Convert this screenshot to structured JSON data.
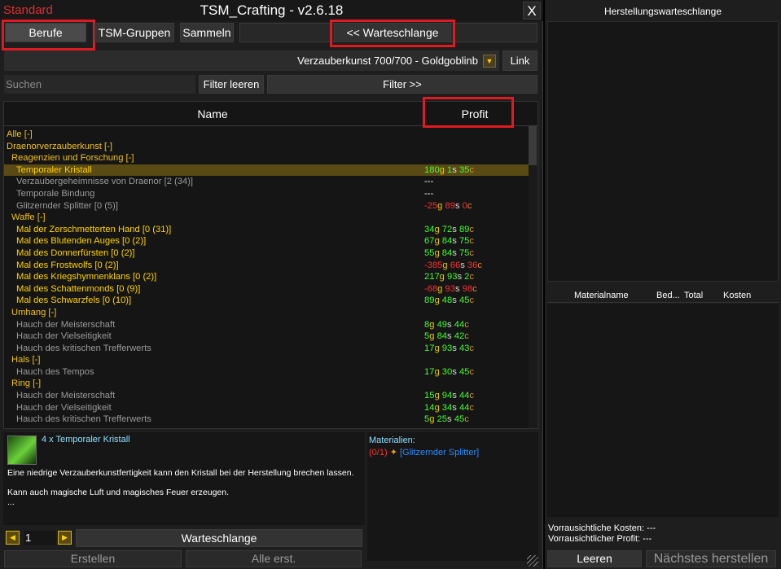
{
  "window": {
    "profile": "Standard",
    "title": "TSM_Crafting - v2.6.18",
    "close": "X"
  },
  "tabs": {
    "berufe": "Berufe",
    "gruppen": "TSM-Gruppen",
    "sammeln": "Sammeln",
    "queue_toggle": "<< Warteschlange"
  },
  "profession": {
    "name": "Verzauberkunst 700/700 - Goldgoblinb",
    "link": "Link"
  },
  "search": {
    "placeholder": "Suchen",
    "clear": "Filter leeren",
    "filter": "Filter >>"
  },
  "columns": {
    "name": "Name",
    "profit": "Profit"
  },
  "rows": [
    {
      "label": "Alle [-]",
      "indent": 0,
      "kind": "header",
      "profit": null
    },
    {
      "label": "Draenorverzauberkunst [-]",
      "indent": 0,
      "kind": "header",
      "profit": null
    },
    {
      "label": "Reagenzien und Forschung [-]",
      "indent": 1,
      "kind": "header",
      "profit": null
    },
    {
      "label": "Temporaler Kristall",
      "indent": 2,
      "kind": "craftable",
      "selected": true,
      "profit": {
        "g": "180",
        "s": "1",
        "c": "35",
        "neg": false
      }
    },
    {
      "label": "Verzaubergeheimnisse von Draenor [2 (34)]",
      "indent": 2,
      "kind": "grey",
      "profit": {
        "text": "---"
      }
    },
    {
      "label": "Temporale Bindung",
      "indent": 2,
      "kind": "grey",
      "profit": {
        "text": "---"
      }
    },
    {
      "label": "Glitzernder Splitter [0 (5)]",
      "indent": 2,
      "kind": "grey",
      "profit": {
        "g": "-25",
        "s": "89",
        "c": "0",
        "neg": true
      }
    },
    {
      "label": "Waffe [-]",
      "indent": 1,
      "kind": "header",
      "profit": null
    },
    {
      "label": "Mal der Zerschmetterten Hand [0 (31)]",
      "indent": 2,
      "kind": "craftable",
      "profit": {
        "g": "34",
        "s": "72",
        "c": "89",
        "neg": false
      }
    },
    {
      "label": "Mal des Blutenden Auges [0 (2)]",
      "indent": 2,
      "kind": "craftable",
      "profit": {
        "g": "67",
        "s": "84",
        "c": "75",
        "neg": false
      }
    },
    {
      "label": "Mal des Donnerfürsten [0 (2)]",
      "indent": 2,
      "kind": "craftable",
      "profit": {
        "g": "55",
        "s": "84",
        "c": "75",
        "neg": false
      }
    },
    {
      "label": "Mal des Frostwolfs [0 (2)]",
      "indent": 2,
      "kind": "craftable",
      "profit": {
        "g": "-385",
        "s": "66",
        "c": "36",
        "neg": true
      }
    },
    {
      "label": "Mal des Kriegshymnenklans [0 (2)]",
      "indent": 2,
      "kind": "craftable",
      "profit": {
        "g": "217",
        "s": "93",
        "c": "2",
        "neg": false
      }
    },
    {
      "label": "Mal des Schattenmonds [0 (9)]",
      "indent": 2,
      "kind": "craftable",
      "profit": {
        "g": "-68",
        "s": "93",
        "c": "98",
        "neg": true
      }
    },
    {
      "label": "Mal des Schwarzfels [0 (10)]",
      "indent": 2,
      "kind": "craftable",
      "profit": {
        "g": "89",
        "s": "48",
        "c": "45",
        "neg": false
      }
    },
    {
      "label": "Umhang [-]",
      "indent": 1,
      "kind": "header",
      "profit": null
    },
    {
      "label": "Hauch der Meisterschaft",
      "indent": 2,
      "kind": "grey",
      "profit": {
        "g": "8",
        "s": "49",
        "c": "44",
        "neg": false
      }
    },
    {
      "label": "Hauch der Vielseitigkeit",
      "indent": 2,
      "kind": "grey",
      "profit": {
        "g": "5",
        "s": "84",
        "c": "42",
        "neg": false
      }
    },
    {
      "label": "Hauch des kritischen Trefferwerts",
      "indent": 2,
      "kind": "grey",
      "profit": {
        "g": "17",
        "s": "93",
        "c": "43",
        "neg": false
      }
    },
    {
      "label": "Hals [-]",
      "indent": 1,
      "kind": "header",
      "profit": null
    },
    {
      "label": "Hauch des Tempos",
      "indent": 2,
      "kind": "grey",
      "profit": {
        "g": "17",
        "s": "30",
        "c": "45",
        "neg": false
      }
    },
    {
      "label": "Ring [-]",
      "indent": 1,
      "kind": "header",
      "profit": null
    },
    {
      "label": "Hauch der Meisterschaft",
      "indent": 2,
      "kind": "grey",
      "profit": {
        "g": "15",
        "s": "94",
        "c": "44",
        "neg": false
      }
    },
    {
      "label": "Hauch der Vielseitigkeit",
      "indent": 2,
      "kind": "grey",
      "profit": {
        "g": "14",
        "s": "34",
        "c": "44",
        "neg": false
      }
    },
    {
      "label": "Hauch des kritischen Trefferwerts",
      "indent": 2,
      "kind": "grey",
      "profit": {
        "g": "5",
        "s": "25",
        "c": "45",
        "neg": false
      }
    }
  ],
  "detail": {
    "title": "4 x Temporaler Kristall",
    "desc1": "Eine niedrige Verzauberkunstfertigkeit kann den Kristall bei der Herstellung brechen lassen.",
    "desc2": "Kann auch magische Luft und magisches Feuer erzeugen.",
    "desc3": "...",
    "mats_title": "Materialien:",
    "mat_count": "(0/1)",
    "mat_name": "[Glitzernder Splitter]"
  },
  "controls": {
    "qty": "1",
    "queue": "Warteschlange",
    "create": "Erstellen",
    "create_all": "Alle erst."
  },
  "queue": {
    "title": "Herstellungswarteschlange",
    "col_mat": "Materialname",
    "col_need": "Bed...",
    "col_total": "Total",
    "col_cost": "Kosten",
    "est_cost": "Vorrausichtliche Kosten: ---",
    "est_profit": "Vorrausichtlicher Profit: ---",
    "clear": "Leeren",
    "next": "Nächstes herstellen"
  },
  "colors": {
    "craftable": "#ffd200",
    "grey": "#9a9a9a",
    "header": "#f0c020",
    "positive": "#40ff30",
    "negative": "#ff3030",
    "selected_bg": "#5a4a14",
    "highlight": "#e01a22"
  }
}
